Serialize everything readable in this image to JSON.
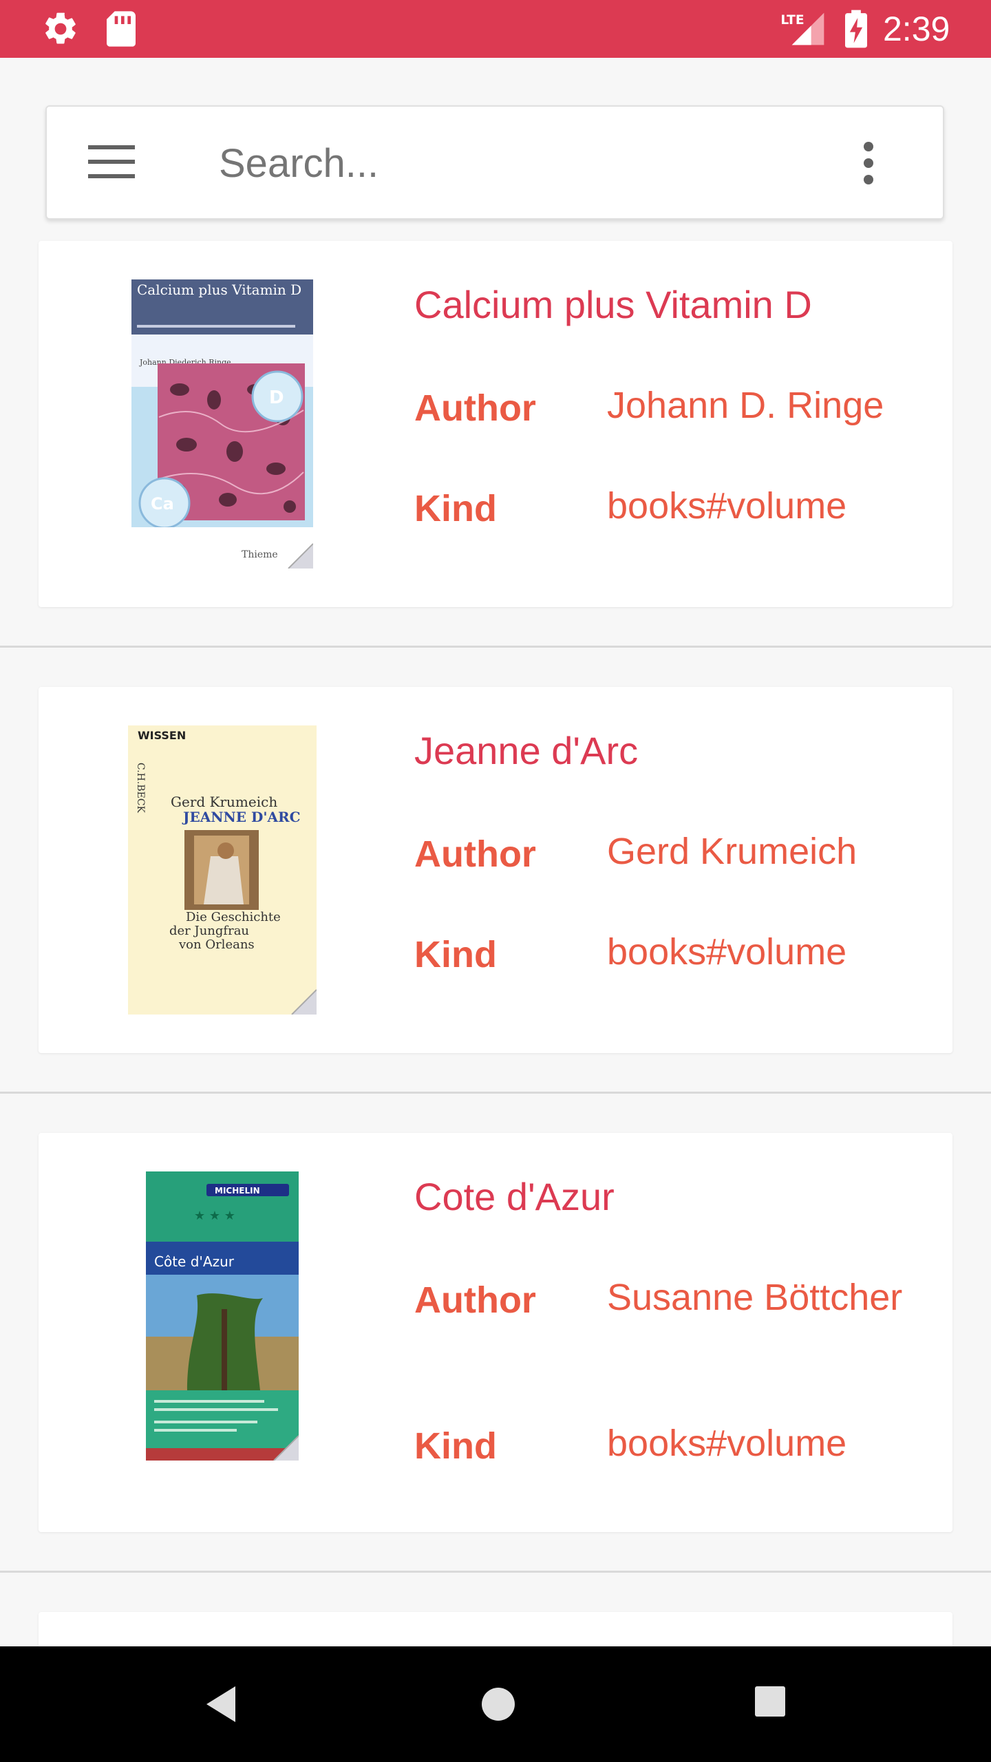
{
  "status_bar": {
    "time": "2:39",
    "network": "LTE",
    "icons": [
      "gear-icon",
      "sd-card-icon",
      "lte-signal-icon",
      "battery-charging-icon"
    ],
    "background": "#dc3a52"
  },
  "search": {
    "placeholder": "Search...",
    "value": "",
    "menu_icon": "hamburger-menu-icon",
    "more_icon": "more-vert-icon"
  },
  "labels": {
    "author": "Author",
    "kind": "Kind"
  },
  "books": [
    {
      "title": "Calcium plus Vitamin D",
      "author": "Johann D. Ringe",
      "kind": "books#volume",
      "cover_text": [
        "Calcium plus Vitamin D",
        "Johann Diederich Ringe",
        "D",
        "Ca",
        "Thieme"
      ]
    },
    {
      "title": "Jeanne d'Arc",
      "author": "Gerd Krumeich",
      "kind": "books#volume",
      "cover_text": [
        "C.H.BECK",
        "WISSEN",
        "Gerd Krumeich",
        "JEANNE D'ARC",
        "Die Geschichte",
        "der Jungfrau",
        "von Orleans"
      ]
    },
    {
      "title": "Cote d'Azur",
      "author": "Susanne Böttcher",
      "kind": "books#volume",
      "cover_text": [
        "MICHELIN",
        "Côte d'Azur"
      ]
    }
  ],
  "colors": {
    "title": "#dc3a52",
    "field": "#ea5a44",
    "background": "#f7f7f7",
    "card": "#ffffff",
    "nav_bar": "#000000"
  },
  "nav_bar": {
    "icons": [
      "back-icon",
      "home-icon",
      "recent-apps-icon"
    ]
  }
}
